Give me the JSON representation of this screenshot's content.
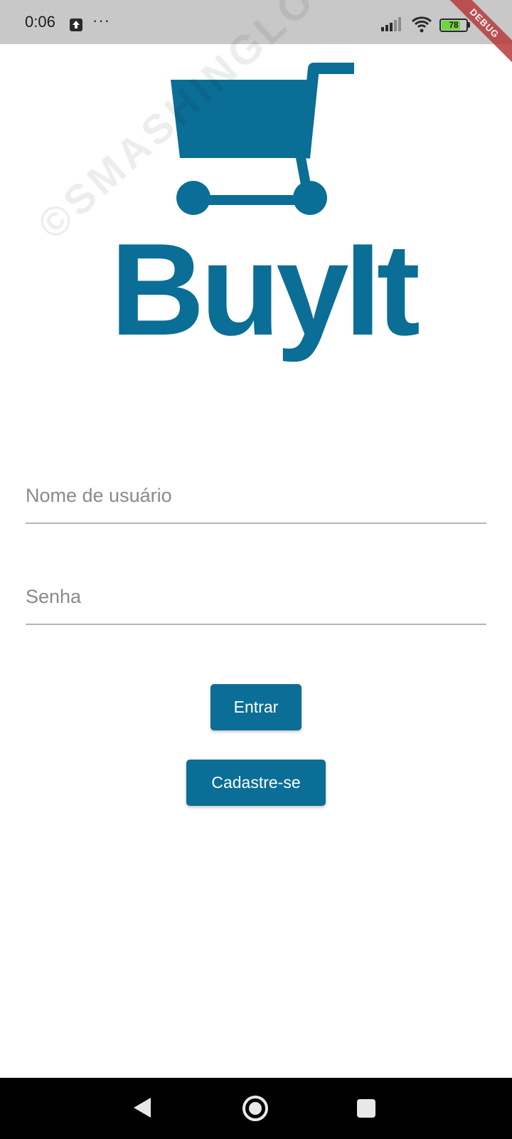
{
  "status_bar": {
    "time": "0:06",
    "more": "···",
    "battery": "78",
    "battery_level": 0.78,
    "icons": [
      "upload-icon",
      "signal-icon",
      "wifi-icon",
      "battery-icon"
    ]
  },
  "debug_banner": "DEBUG",
  "logo": {
    "text": "BuyIt",
    "watermark": "©SMASHINGLOGO",
    "color": "#0b6e96"
  },
  "form": {
    "username_placeholder": "Nome de usuário",
    "password_placeholder": "Senha",
    "login_label": "Entrar",
    "signup_label": "Cadastre-se"
  },
  "nav_bar": {
    "icons": [
      "back-icon",
      "home-icon",
      "recents-icon"
    ]
  }
}
